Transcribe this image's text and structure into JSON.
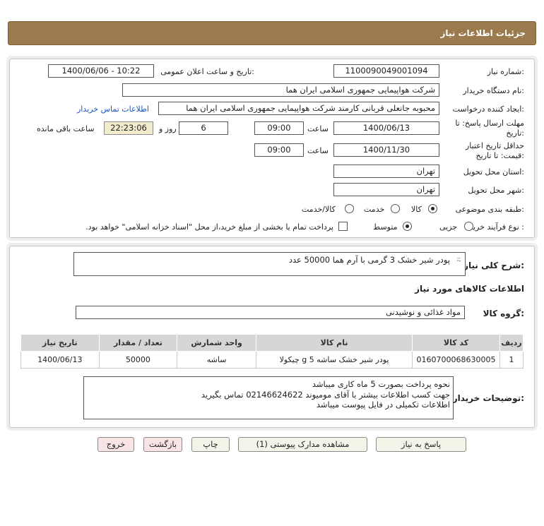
{
  "header": {
    "title": "جزئیات اطلاعات نیاز"
  },
  "form": {
    "need_number_label": "شماره نیاز:",
    "need_number": "1100090049001094",
    "announce_label": "تاریخ و ساعت اعلان عمومی:",
    "announce_value": "1400/06/06 - 10:22",
    "buyer_org_label": "نام دستگاه خریدار:",
    "buyer_org": "شرکت هواپیمایی جمهوری اسلامی ایران هما",
    "requester_label": "ایجاد کننده درخواست:",
    "requester": "محبوبه جانعلی قربانی کارمند شرکت هواپیمایی جمهوری اسلامی ایران هما",
    "contact_link": "اطلاعات تماس خریدار",
    "deadline_label_1": "مهلت ارسال پاسخ: تا",
    "deadline_label_2": "تاریخ:",
    "deadline_date": "1400/06/13",
    "time_label": "ساعت",
    "deadline_time": "09:00",
    "days_value": "6",
    "days_label": "روز و",
    "remaining_time": "22:23:06",
    "remaining_label": "ساعت باقی مانده",
    "validity_label_1": "حداقل تاریخ اعتبار",
    "validity_label_2": "قیمت: تا تاریخ:",
    "validity_date": "1400/11/30",
    "validity_time_label": "ساعت",
    "validity_time": "09:00",
    "delivery_province_label": "استان محل تحویل:",
    "delivery_province": "تهران",
    "delivery_city_label": "شهر محل تحویل:",
    "delivery_city": "تهران",
    "category_label": "طبقه بندی موضوعی:",
    "category_options": [
      "کالا",
      "خدمت",
      "کالا/خدمت"
    ],
    "category_selected": "کالا",
    "process_label": "نوع فرآیند خرید :",
    "process_options": [
      "جزیی",
      "متوسط"
    ],
    "process_selected": "متوسط",
    "payment_note": "پرداخت تمام یا بخشی از مبلغ خرید،از محل \"اسناد خزانه اسلامی\" خواهد بود."
  },
  "details": {
    "summary_label": "شرح کلی نیاز:",
    "summary": "پودر شیر خشک 3 گرمی با آرم هما  50000 عدد",
    "goods_info_title": "اطلاعات کالاهای مورد نیاز",
    "goods_group_label": "گروه کالا:",
    "goods_group": "مواد غذائی و نوشیدنی",
    "table": {
      "headers": [
        "ردیف",
        "کد کالا",
        "نام کالا",
        "واحد شمارش",
        "تعداد / مقدار",
        "تاریخ نیاز"
      ],
      "rows": [
        [
          "1",
          "0160700068630005",
          "پودر شیر خشک ساشه 5 g چیکولا",
          "ساشه",
          "50000",
          "1400/06/13"
        ]
      ]
    },
    "buyer_notes_label": "توضیحات خریدار:",
    "buyer_notes": [
      "نحوه پرداخت بصورت 5 ماه کاری میباشد",
      "جهت کسب اطلاعات بیشتر با آقای مومیوند 02146624622 تماس بگیرید",
      "اطلاعات تکمیلی در فایل پیوست میباشد"
    ]
  },
  "buttons": {
    "reply": "پاسخ به نیاز",
    "attachments": "مشاهده مدارک پیوستی (1)",
    "print": "چاپ",
    "back": "بازگشت",
    "exit": "خروج"
  },
  "colors": {
    "header_bg": "#9b7a4e",
    "link": "#1a56c6",
    "remaining_bg": "#f1eccb"
  }
}
